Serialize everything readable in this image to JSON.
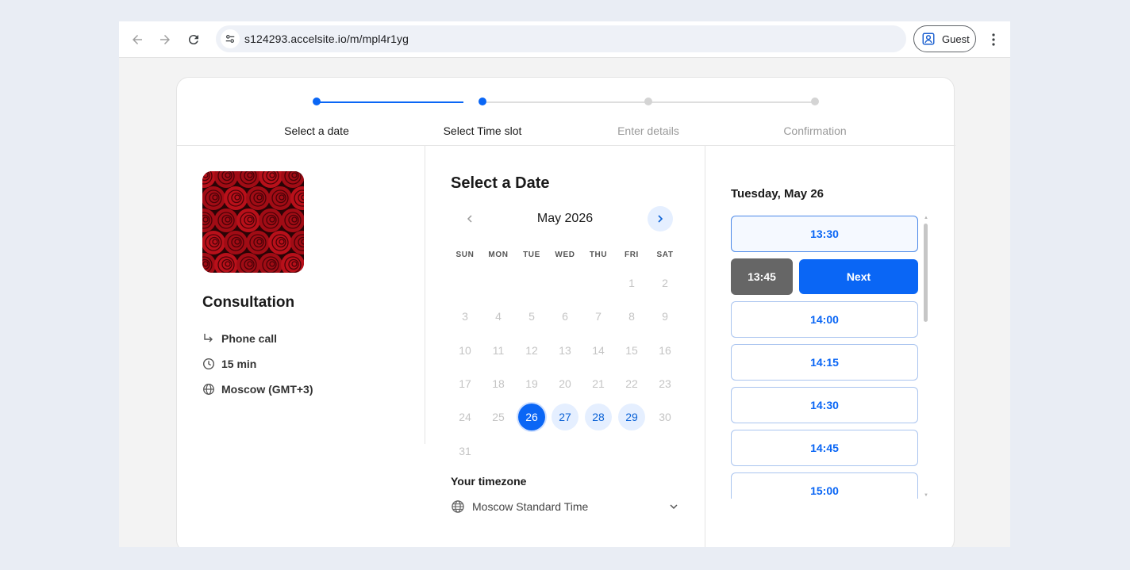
{
  "browser": {
    "url": "s124293.accelsite.io/m/mpl4r1yg",
    "profile_label": "Guest"
  },
  "stepper": {
    "steps": [
      {
        "label": "Select a date",
        "state": "done"
      },
      {
        "label": "Select Time slot",
        "state": "active"
      },
      {
        "label": "Enter details",
        "state": "pending"
      },
      {
        "label": "Confirmation",
        "state": "pending"
      }
    ]
  },
  "service": {
    "title": "Consultation",
    "location": "Phone call",
    "duration": "15 min",
    "timezone": "Moscow (GMT+3)"
  },
  "calendar": {
    "title": "Select a Date",
    "month_label": "May 2026",
    "weekdays": [
      "SUN",
      "MON",
      "TUE",
      "WED",
      "THU",
      "FRI",
      "SAT"
    ],
    "weeks": [
      [
        "",
        "",
        "",
        "",
        "",
        "1",
        "2"
      ],
      [
        "3",
        "4",
        "5",
        "6",
        "7",
        "8",
        "9"
      ],
      [
        "10",
        "11",
        "12",
        "13",
        "14",
        "15",
        "16"
      ],
      [
        "17",
        "18",
        "19",
        "20",
        "21",
        "22",
        "23"
      ],
      [
        "24",
        "25",
        "26",
        "27",
        "28",
        "29",
        "30"
      ],
      [
        "31",
        "",
        "",
        "",
        "",
        "",
        ""
      ]
    ],
    "available_days": [
      "27",
      "28",
      "29"
    ],
    "selected_day": "26",
    "timezone_label": "Your timezone",
    "timezone_value": "Moscow Standard Time"
  },
  "slots": {
    "date_heading": "Tuesday, May 26",
    "items": [
      {
        "time": "13:30"
      },
      {
        "time": "13:45",
        "chosen": true
      },
      {
        "time": "14:00"
      },
      {
        "time": "14:15"
      },
      {
        "time": "14:30"
      },
      {
        "time": "14:45"
      },
      {
        "time": "15:00"
      }
    ],
    "next_label": "Next"
  },
  "colors": {
    "accent": "#0a66f5",
    "available_bg": "#e5efff",
    "chosen_slot_bg": "#666666"
  }
}
